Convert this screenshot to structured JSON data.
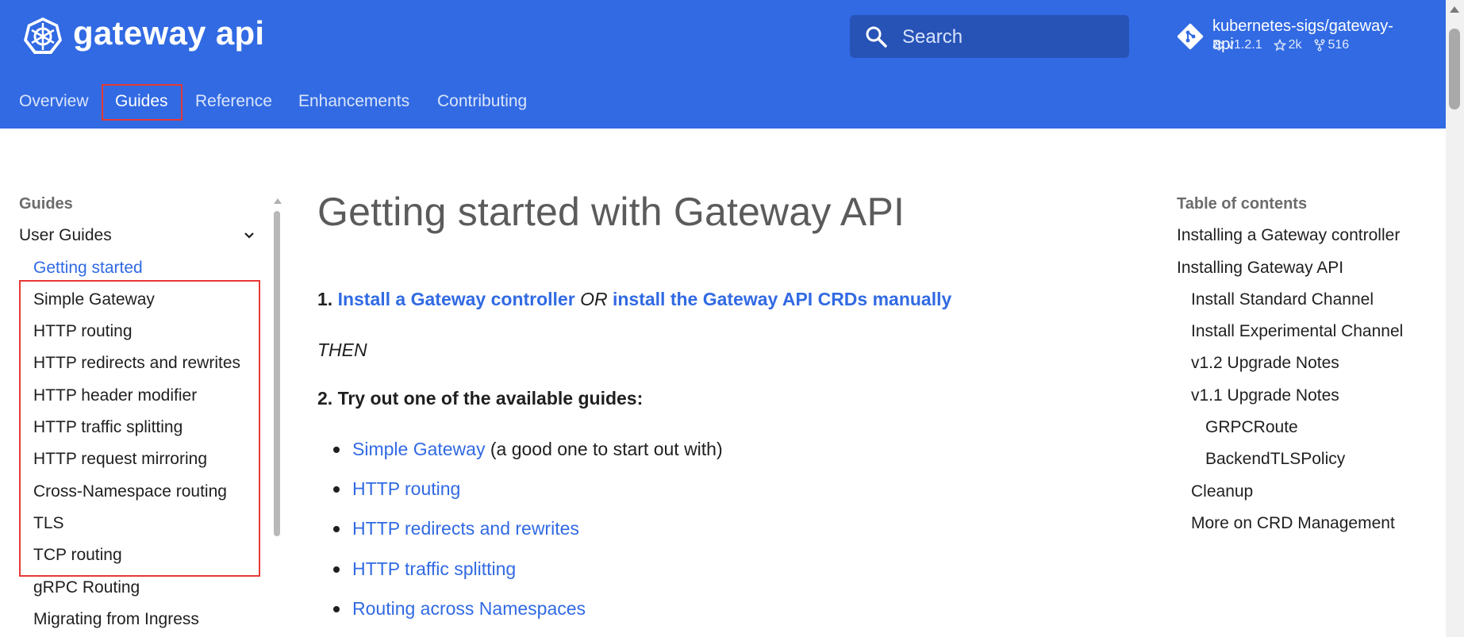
{
  "header": {
    "site_name": "gateway api",
    "search": {
      "placeholder": "Search"
    },
    "repo": {
      "name": "kubernetes-sigs/gateway-api",
      "version": "v1.2.1",
      "stars": "2k",
      "forks": "516"
    },
    "tabs": [
      {
        "label": "Overview"
      },
      {
        "label": "Guides",
        "active": true
      },
      {
        "label": "Reference"
      },
      {
        "label": "Enhancements"
      },
      {
        "label": "Contributing"
      }
    ]
  },
  "sidebar": {
    "title": "Guides",
    "group": "User Guides",
    "items": [
      {
        "label": "Getting started",
        "current": true
      },
      {
        "label": "Simple Gateway"
      },
      {
        "label": "HTTP routing"
      },
      {
        "label": "HTTP redirects and rewrites"
      },
      {
        "label": "HTTP header modifier"
      },
      {
        "label": "HTTP traffic splitting"
      },
      {
        "label": "HTTP request mirroring"
      },
      {
        "label": "Cross-Namespace routing"
      },
      {
        "label": "TLS"
      },
      {
        "label": "TCP routing"
      },
      {
        "label": "gRPC Routing"
      },
      {
        "label": "Migrating from Ingress"
      }
    ]
  },
  "main": {
    "title": "Getting started with Gateway API",
    "step1": {
      "number": "1.",
      "link1": "Install a Gateway controller",
      "or": "OR",
      "link2": "install the Gateway API CRDs manually"
    },
    "then": "THEN",
    "step2": "2. Try out one of the available guides:",
    "guides": [
      {
        "label": "Simple Gateway",
        "note": "(a good one to start out with)"
      },
      {
        "label": "HTTP routing",
        "note": ""
      },
      {
        "label": "HTTP redirects and rewrites",
        "note": ""
      },
      {
        "label": "HTTP traffic splitting",
        "note": ""
      },
      {
        "label": "Routing across Namespaces",
        "note": ""
      }
    ]
  },
  "toc": {
    "title": "Table of contents",
    "items": [
      {
        "label": "Installing a Gateway controller",
        "level": 0
      },
      {
        "label": "Installing Gateway API",
        "level": 0
      },
      {
        "label": "Install Standard Channel",
        "level": 1
      },
      {
        "label": "Install Experimental Channel",
        "level": 1
      },
      {
        "label": "v1.2 Upgrade Notes",
        "level": 1
      },
      {
        "label": "v1.1 Upgrade Notes",
        "level": 1
      },
      {
        "label": "GRPCRoute",
        "level": 2
      },
      {
        "label": "BackendTLSPolicy",
        "level": 2
      },
      {
        "label": "Cleanup",
        "level": 1
      },
      {
        "label": "More on CRD Management",
        "level": 1
      }
    ]
  },
  "colors": {
    "header_bg": "#316ae3",
    "link": "#316ae3",
    "highlight_box": "#e53935"
  }
}
